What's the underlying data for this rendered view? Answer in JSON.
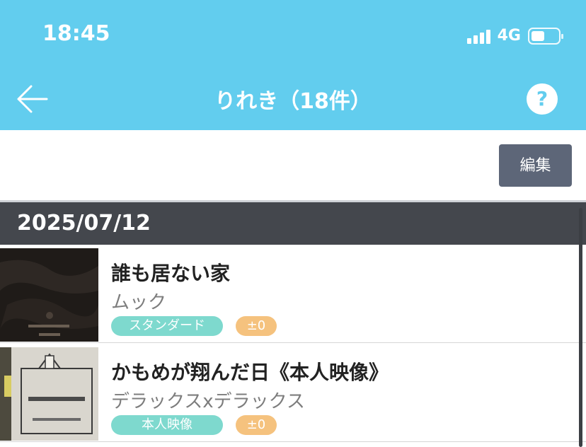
{
  "status_bar": {
    "time": "18:45",
    "network": "4G"
  },
  "nav": {
    "title": "りれき（18件）",
    "help_label": "?"
  },
  "toolbar": {
    "edit_label": "編集"
  },
  "history": {
    "date": "2025/07/12",
    "items": [
      {
        "title": "誰も居ない家",
        "artist": "ムック",
        "type": "スタンダード",
        "score": "±0"
      },
      {
        "title": "かもめが翔んだ日《本人映像》",
        "artist": "デラックスxデラックス",
        "type": "本人映像",
        "score": "±0"
      }
    ]
  },
  "colors": {
    "header": "#62cdee",
    "edit_button": "#5d6678",
    "date_bar": "#44474d",
    "tag": "#7ed9ce",
    "score": "#f5c27e"
  }
}
